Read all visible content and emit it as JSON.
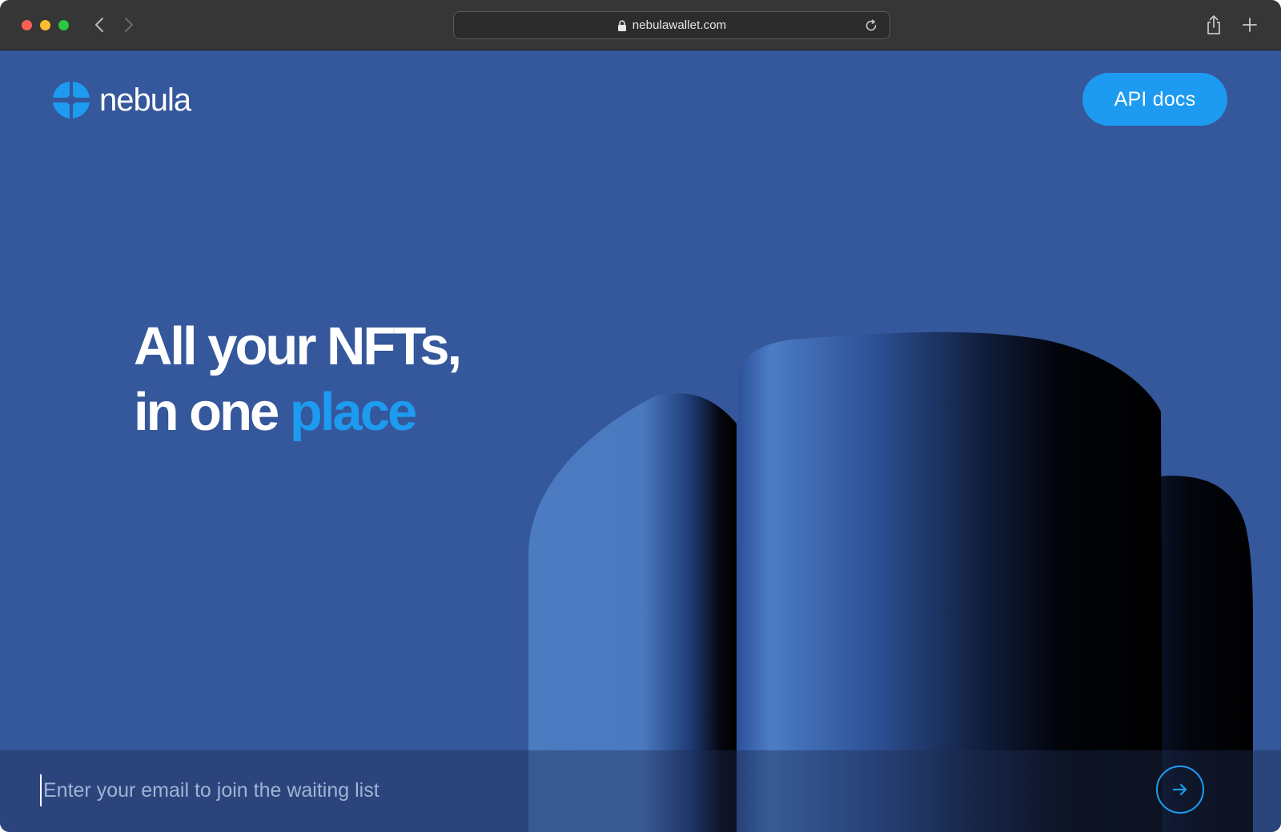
{
  "browser": {
    "url": "nebulawallet.com",
    "icons": {
      "lock": "lock-icon",
      "reload": "reload-icon",
      "back": "chevron-left-icon",
      "forward": "chevron-right-icon",
      "share": "share-icon",
      "new_tab": "plus-icon"
    }
  },
  "header": {
    "brand_name": "nebula",
    "api_button_label": "API docs"
  },
  "hero": {
    "line1": "All your NFTs,",
    "line2_prefix": "in one ",
    "line2_accent": "place"
  },
  "waitlist": {
    "placeholder": "Enter your email to join the waiting list",
    "value": "",
    "submit_icon": "arrow-right-icon"
  },
  "colors": {
    "background": "#35579b",
    "accent": "#1d9bf0",
    "text": "#ffffff"
  }
}
